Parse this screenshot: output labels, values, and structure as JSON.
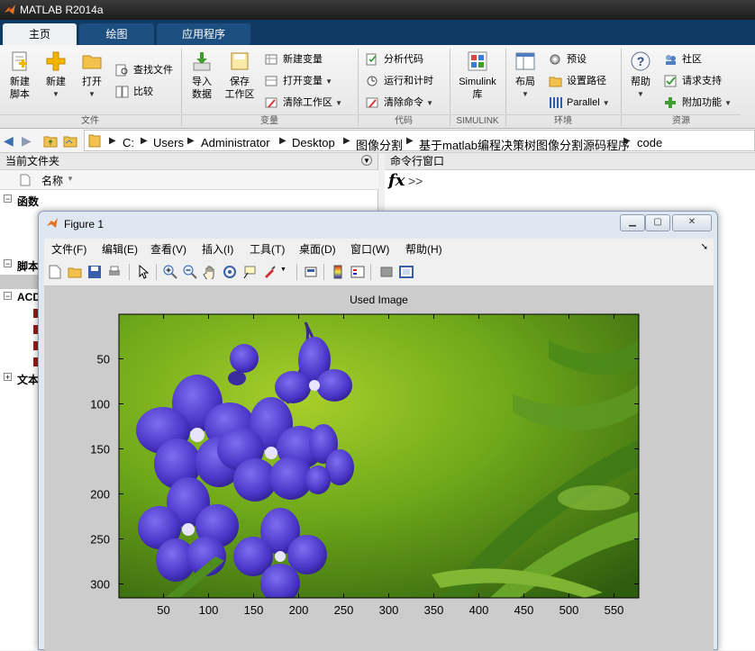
{
  "window": {
    "title": "MATLAB R2014a"
  },
  "tabs": [
    {
      "label": "主页",
      "active": true
    },
    {
      "label": "绘图",
      "active": false
    },
    {
      "label": "应用程序",
      "active": false
    }
  ],
  "ribbon": {
    "groups": {
      "file": "文件",
      "variable": "变量",
      "code": "代码",
      "simulink": "SIMULINK",
      "env": "环境",
      "resources": "资源"
    },
    "new_script": "新建\n脚本",
    "new_script_l1": "新建",
    "new_script_l2": "脚本",
    "new": "新建",
    "open": "打开",
    "find_files": "查找文件",
    "compare": "比较",
    "import_l1": "导入",
    "import_l2": "数据",
    "save_l1": "保存",
    "save_l2": "工作区",
    "new_var": "新建变量",
    "open_var": "打开变量",
    "clear_ws": "清除工作区",
    "analyze_code": "分析代码",
    "run_time": "运行和计时",
    "clear_cmd": "清除命令",
    "simulink_l1": "Simulink",
    "simulink_l2": "库",
    "layout": "布局",
    "preferences": "预设",
    "set_path": "设置路径",
    "parallel": "Parallel",
    "help": "帮助",
    "community": "社区",
    "request_support": "请求支持",
    "addons": "附加功能"
  },
  "address": {
    "crumbs": [
      "C:",
      "Users",
      "Administrator",
      "Desktop",
      "图像分割",
      "基于matlab编程决策树图像分割源码程序",
      "code"
    ]
  },
  "current_folder": {
    "title": "当前文件夹",
    "name_col": "名称",
    "groups": [
      "函数",
      "脚本",
      "ACD",
      "文本"
    ]
  },
  "command_window": {
    "title": "命令行窗口",
    "fx": "fx",
    "prompt": ">>"
  },
  "figure": {
    "title": "Figure 1",
    "menu": [
      "文件(F)",
      "编辑(E)",
      "查看(V)",
      "插入(I)",
      "工具(T)",
      "桌面(D)",
      "窗口(W)",
      "帮助(H)"
    ],
    "toolbar_icons": [
      "new-figure-icon",
      "open-file-icon",
      "save-icon",
      "print-icon",
      "pointer-icon",
      "zoom-in-icon",
      "zoom-out-icon",
      "pan-hand-icon",
      "rotate-icon",
      "data-cursor-icon",
      "brush-icon",
      "link-icon",
      "colorbar-icon",
      "legend-icon",
      "hide-plot-tools-icon",
      "show-plot-tools-icon"
    ],
    "axes_title": "Used Image",
    "x_ticks": [
      "50",
      "100",
      "150",
      "200",
      "250",
      "300",
      "350",
      "400",
      "450",
      "500",
      "550"
    ],
    "y_ticks": [
      "50",
      "100",
      "150",
      "200",
      "250",
      "300"
    ],
    "image_description_colors": {
      "background": "#5f9b12",
      "flower": "#4b3fc8"
    }
  }
}
